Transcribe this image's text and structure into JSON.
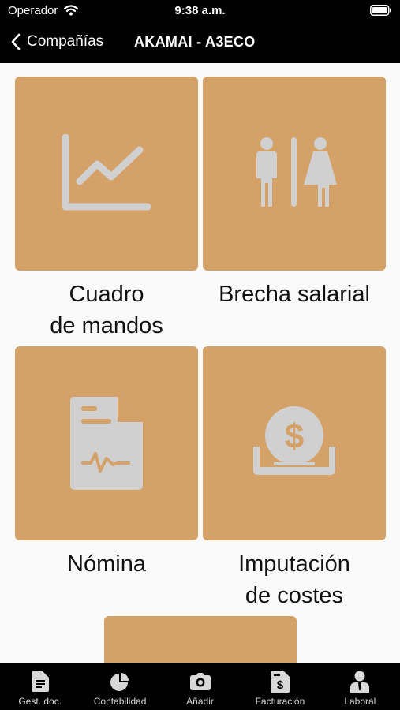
{
  "status_bar": {
    "carrier": "Operador",
    "time": "9:38 a.m."
  },
  "nav": {
    "back_label": "Compañías",
    "title": "AKAMAI - A3ECO"
  },
  "tiles": [
    {
      "line1": "Cuadro",
      "line2": "de mandos",
      "icon": "line-chart-icon"
    },
    {
      "line1": "Brecha salarial",
      "line2": "",
      "icon": "restroom-icon"
    },
    {
      "line1": "Nómina",
      "line2": "",
      "icon": "payslip-document-icon"
    },
    {
      "line1": "Imputación",
      "line2": "de costes",
      "icon": "coin-dollar-icon"
    }
  ],
  "tab_bar": [
    {
      "label": "Gest. doc.",
      "icon": "document-icon"
    },
    {
      "label": "Contabilidad",
      "icon": "pie-chart-icon"
    },
    {
      "label": "Añadir",
      "icon": "camera-icon"
    },
    {
      "label": "Facturación",
      "icon": "invoice-icon"
    },
    {
      "label": "Laboral",
      "icon": "worker-icon"
    }
  ],
  "colors": {
    "tile": "#d4a169",
    "icon": "#d0d0d0",
    "bars": "#000000",
    "background": "#fafafa"
  }
}
